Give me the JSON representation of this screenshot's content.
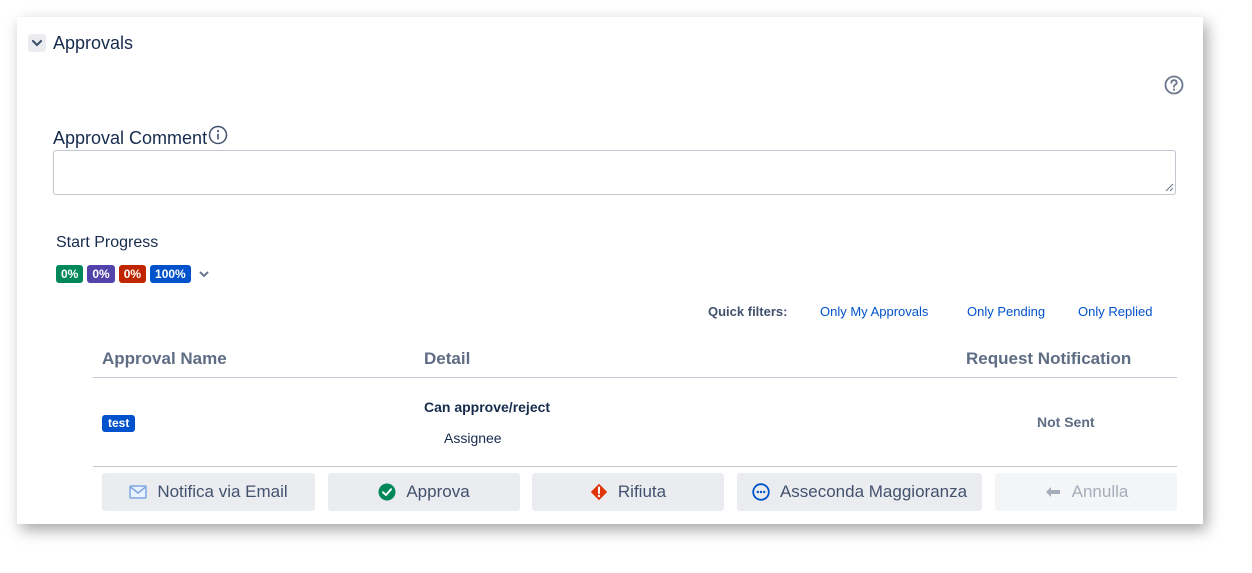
{
  "section": {
    "title": "Approvals"
  },
  "comment": {
    "label": "Approval Comment",
    "value": "",
    "placeholder": ""
  },
  "progress": {
    "label": "Start Progress",
    "badges": [
      {
        "text": "0%",
        "color": "#00875a"
      },
      {
        "text": "0%",
        "color": "#5243aa"
      },
      {
        "text": "0%",
        "color": "#bf2600"
      },
      {
        "text": "100%",
        "color": "#0052cc"
      }
    ]
  },
  "quick_filters": {
    "label": "Quick filters:",
    "links": [
      "Only My Approvals",
      "Only Pending",
      "Only Replied"
    ]
  },
  "table": {
    "headers": [
      "Approval Name",
      "Detail",
      "Request Notification"
    ],
    "rows": [
      {
        "name": "test",
        "detail_title": "Can approve/reject",
        "detail_sub": "Assignee",
        "notification": "Not Sent"
      }
    ]
  },
  "actions": [
    {
      "label": "Notifica via Email",
      "icon": "envelope-icon"
    },
    {
      "label": "Approva",
      "icon": "check-circle-icon"
    },
    {
      "label": "Rifiuta",
      "icon": "warning-diamond-icon"
    },
    {
      "label": "Asseconda Maggioranza",
      "icon": "ellipsis-circle-icon"
    },
    {
      "label": "Annulla",
      "icon": "undo-arrow-icon",
      "disabled": true
    }
  ],
  "colors": {
    "link": "#0052cc",
    "approve": "#00875a",
    "reject": "#de350b",
    "majority": "#0052cc"
  }
}
